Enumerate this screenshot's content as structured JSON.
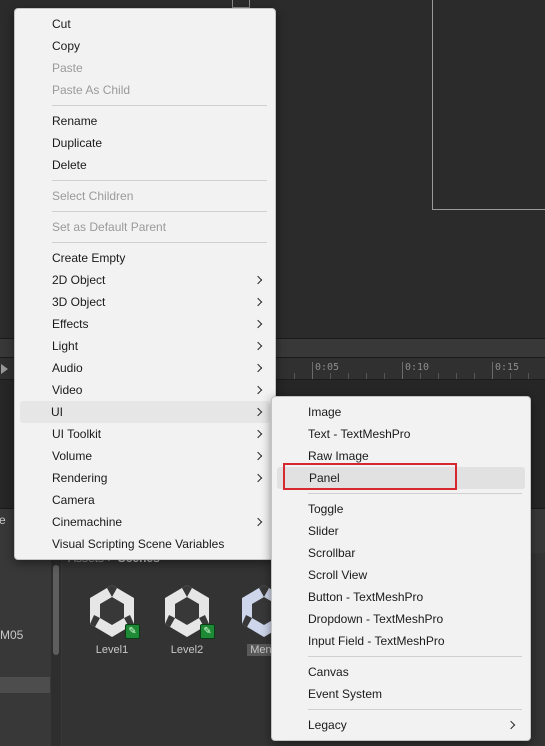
{
  "timeline": {
    "ticks": [
      "0:05",
      "0:10",
      "0:15"
    ]
  },
  "project": {
    "left_pane_fragment_top": "e",
    "left_pane_fragment_mid": "M05",
    "breadcrumb": {
      "root": "Assets",
      "separator": ">",
      "current": "Scenes"
    },
    "assets": [
      {
        "label": "Level1",
        "icon": "unity-scene-icon"
      },
      {
        "label": "Level2",
        "icon": "unity-scene-icon"
      },
      {
        "label": "Menu",
        "icon": "unity-scene-icon"
      }
    ]
  },
  "context_menu": {
    "groups": [
      [
        {
          "label": "Cut",
          "enabled": true
        },
        {
          "label": "Copy",
          "enabled": true
        },
        {
          "label": "Paste",
          "enabled": false
        },
        {
          "label": "Paste As Child",
          "enabled": false
        }
      ],
      [
        {
          "label": "Rename",
          "enabled": true
        },
        {
          "label": "Duplicate",
          "enabled": true
        },
        {
          "label": "Delete",
          "enabled": true
        }
      ],
      [
        {
          "label": "Select Children",
          "enabled": false
        }
      ],
      [
        {
          "label": "Set as Default Parent",
          "enabled": false
        }
      ],
      [
        {
          "label": "Create Empty",
          "enabled": true
        },
        {
          "label": "2D Object",
          "enabled": true,
          "submenu": true
        },
        {
          "label": "3D Object",
          "enabled": true,
          "submenu": true
        },
        {
          "label": "Effects",
          "enabled": true,
          "submenu": true
        },
        {
          "label": "Light",
          "enabled": true,
          "submenu": true
        },
        {
          "label": "Audio",
          "enabled": true,
          "submenu": true
        },
        {
          "label": "Video",
          "enabled": true,
          "submenu": true
        },
        {
          "label": "UI",
          "enabled": true,
          "submenu": true,
          "hovered": true
        },
        {
          "label": "UI Toolkit",
          "enabled": true,
          "submenu": true
        },
        {
          "label": "Volume",
          "enabled": true,
          "submenu": true
        },
        {
          "label": "Rendering",
          "enabled": true,
          "submenu": true
        },
        {
          "label": "Camera",
          "enabled": true
        },
        {
          "label": "Cinemachine",
          "enabled": true,
          "submenu": true
        },
        {
          "label": "Visual Scripting Scene Variables",
          "enabled": true
        }
      ]
    ]
  },
  "ui_submenu": {
    "groups": [
      [
        {
          "label": "Image"
        },
        {
          "label": "Text - TextMeshPro"
        },
        {
          "label": "Raw Image"
        },
        {
          "label": "Panel",
          "highlighted": true
        }
      ],
      [
        {
          "label": "Toggle"
        },
        {
          "label": "Slider"
        },
        {
          "label": "Scrollbar"
        },
        {
          "label": "Scroll View"
        },
        {
          "label": "Button - TextMeshPro"
        },
        {
          "label": "Dropdown - TextMeshPro"
        },
        {
          "label": "Input Field - TextMeshPro"
        }
      ],
      [
        {
          "label": "Canvas"
        },
        {
          "label": "Event System"
        }
      ],
      [
        {
          "label": "Legacy",
          "submenu": true
        }
      ]
    ]
  },
  "colors": {
    "highlight_box": "#d6282f",
    "menu_bg": "#f2f2f2",
    "scene_badge": "#1e8a35"
  }
}
